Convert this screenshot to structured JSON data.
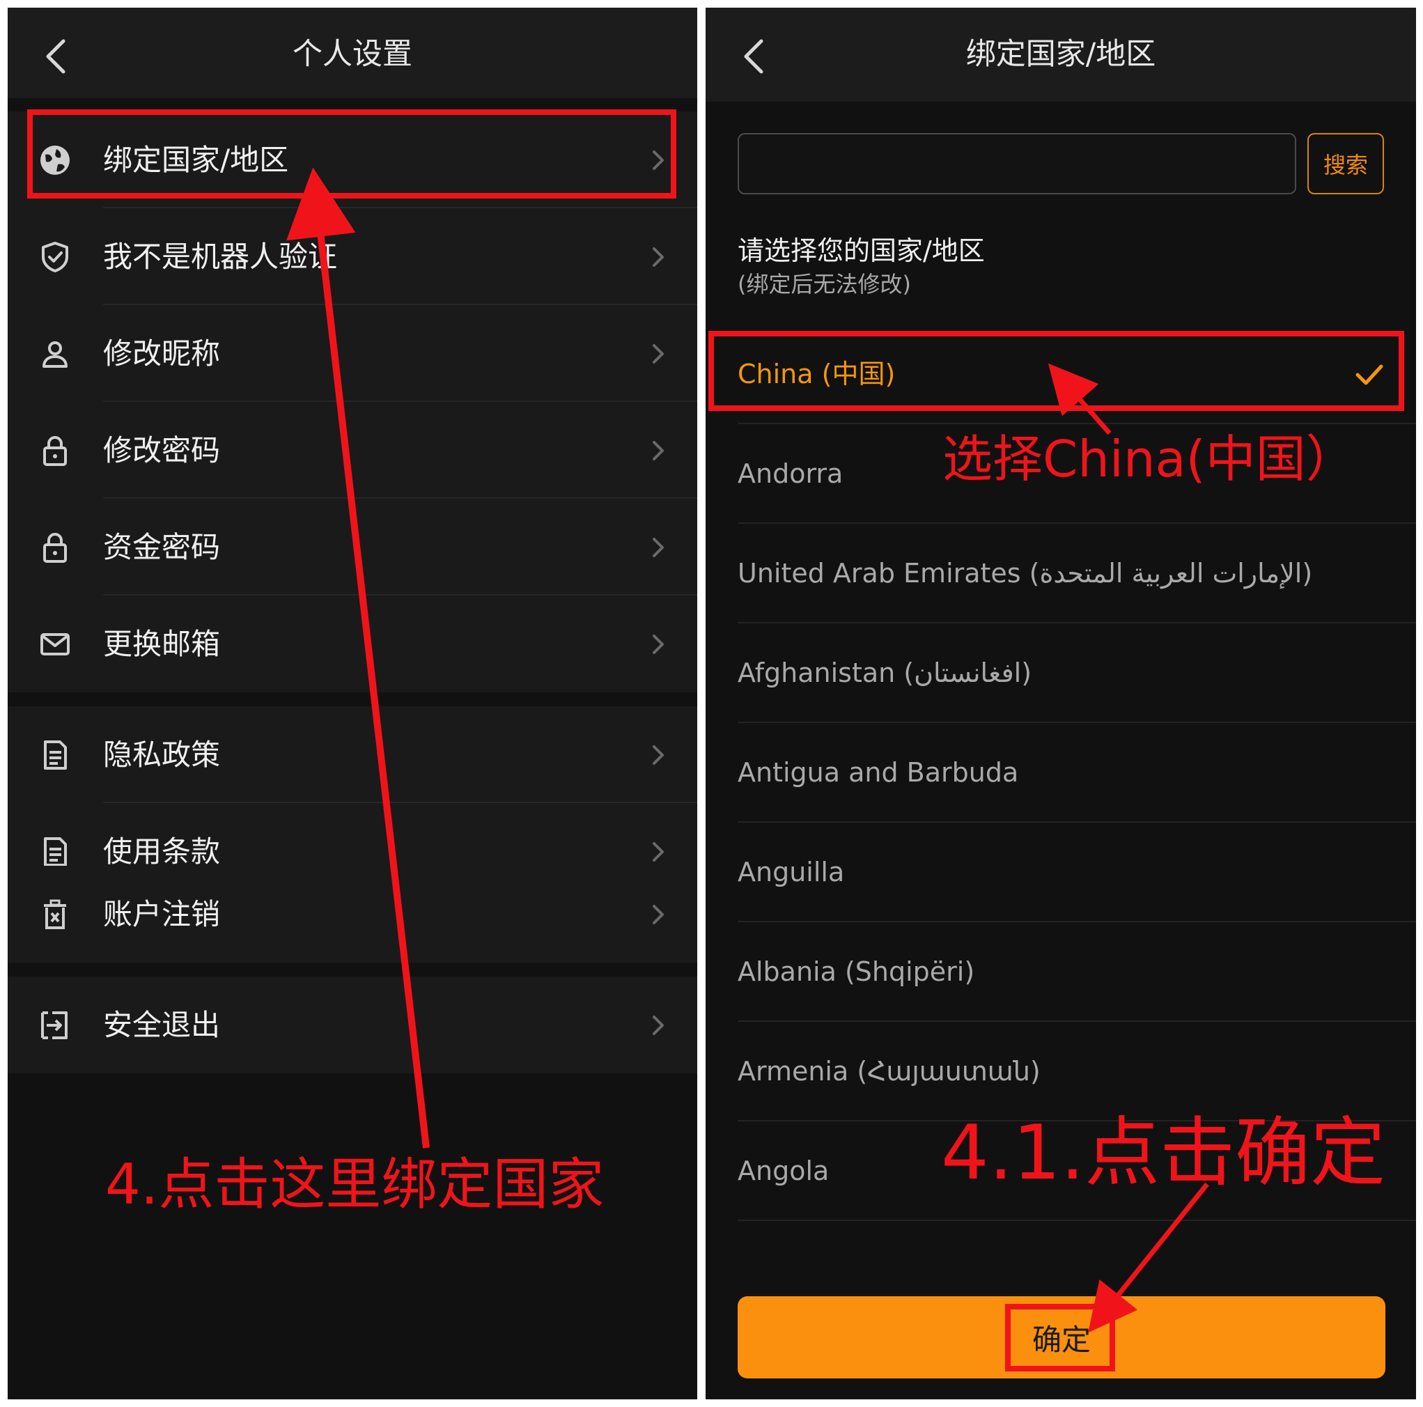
{
  "left": {
    "title": "个人设置",
    "groups": [
      [
        {
          "label": "绑定国家/地区",
          "icon": "globe-icon"
        },
        {
          "label": "我不是机器人验证",
          "icon": "shield-check-icon"
        },
        {
          "label": "修改昵称",
          "icon": "user-icon"
        },
        {
          "label": "修改密码",
          "icon": "lock-icon"
        },
        {
          "label": "资金密码",
          "icon": "lock-icon"
        },
        {
          "label": "更换邮箱",
          "icon": "mail-icon"
        }
      ],
      [
        {
          "label": "隐私政策",
          "icon": "document-icon"
        },
        {
          "label": "使用条款",
          "icon": "document-icon"
        }
      ],
      [
        {
          "label": "账户注销",
          "icon": "trash-icon"
        }
      ],
      [
        {
          "label": "安全退出",
          "icon": "logout-icon"
        }
      ]
    ],
    "annotation": "4.点击这里绑定国家"
  },
  "right": {
    "title": "绑定国家/地区",
    "search": {
      "value": "",
      "placeholder": "",
      "button": "搜索"
    },
    "prompt": "请选择您的国家/地区",
    "hint": "(绑定后无法修改)",
    "countries": [
      {
        "name": "China (中国)",
        "selected": true
      },
      {
        "name": "Andorra",
        "selected": false
      },
      {
        "name": "United Arab Emirates (الإمارات العربية المتحدة)",
        "selected": false
      },
      {
        "name": "Afghanistan (افغانستان)",
        "selected": false
      },
      {
        "name": "Antigua and Barbuda",
        "selected": false
      },
      {
        "name": "Anguilla",
        "selected": false
      },
      {
        "name": "Albania (Shqipëri)",
        "selected": false
      },
      {
        "name": "Armenia (Հայաստան)",
        "selected": false
      },
      {
        "name": "Angola",
        "selected": false
      }
    ],
    "confirm": "确定",
    "annotation_select": "选择China(中国）",
    "annotation_confirm": "4.1.点击确定"
  },
  "colors": {
    "accent": "#fa900e",
    "annotation_red": "#f0141a",
    "background": "#111111"
  }
}
